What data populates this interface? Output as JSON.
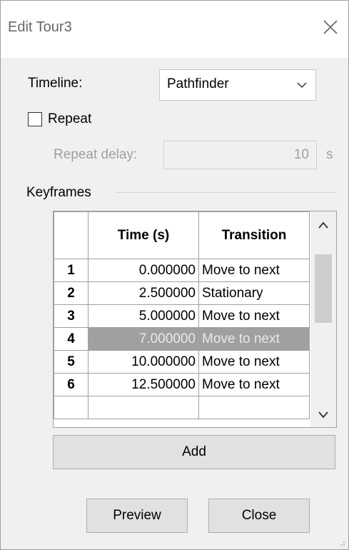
{
  "window": {
    "title": "Edit Tour3"
  },
  "timeline": {
    "label": "Timeline:",
    "selected": "Pathfinder"
  },
  "repeat": {
    "label": "Repeat",
    "checked": false
  },
  "repeat_delay": {
    "label": "Repeat delay:",
    "value": "10",
    "unit": "s"
  },
  "keyframes": {
    "group_label": "Keyframes",
    "columns": [
      "",
      "Time (s)",
      "Transition"
    ],
    "rows": [
      {
        "num": "1",
        "time": "0.000000",
        "transition": "Move to next"
      },
      {
        "num": "2",
        "time": "2.500000",
        "transition": "Stationary"
      },
      {
        "num": "3",
        "time": "5.000000",
        "transition": "Move to next"
      },
      {
        "num": "4",
        "time": "7.000000",
        "transition": "Move to next",
        "selected": true
      },
      {
        "num": "5",
        "time": "10.000000",
        "transition": "Move to next"
      },
      {
        "num": "6",
        "time": "12.500000",
        "transition": "Move to next"
      }
    ]
  },
  "buttons": {
    "add": "Add",
    "preview": "Preview",
    "close": "Close"
  },
  "icons": [
    "close-icon",
    "chevron-down-icon",
    "scroll-up-icon",
    "scroll-down-icon",
    "resize-grip-icon"
  ]
}
